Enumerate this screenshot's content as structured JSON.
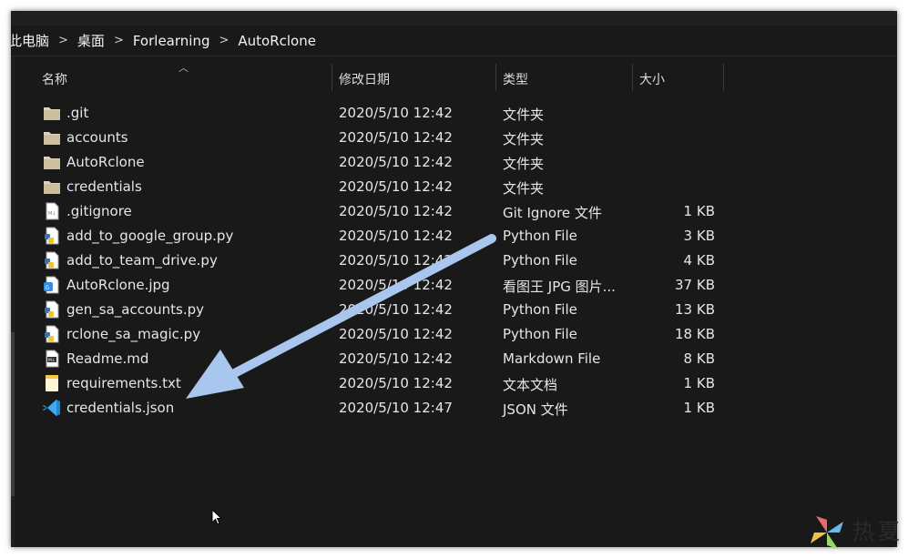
{
  "breadcrumb": [
    "此电脑",
    "桌面",
    "Forlearning",
    "AutoRclone"
  ],
  "columns": {
    "name": "名称",
    "date": "修改日期",
    "type": "类型",
    "size": "大小"
  },
  "files": [
    {
      "name": ".git",
      "date": "2020/5/10 12:42",
      "type": "文件夹",
      "size": "",
      "icon": "folder-icon"
    },
    {
      "name": "accounts",
      "date": "2020/5/10 12:42",
      "type": "文件夹",
      "size": "",
      "icon": "folder-icon"
    },
    {
      "name": "AutoRclone",
      "date": "2020/5/10 12:42",
      "type": "文件夹",
      "size": "",
      "icon": "folder-icon"
    },
    {
      "name": "credentials",
      "date": "2020/5/10 12:42",
      "type": "文件夹",
      "size": "",
      "icon": "folder-icon"
    },
    {
      "name": ".gitignore",
      "date": "2020/5/10 12:42",
      "type": "Git Ignore 文件",
      "size": "1 KB",
      "icon": "file-icon"
    },
    {
      "name": "add_to_google_group.py",
      "date": "2020/5/10 12:42",
      "type": "Python File",
      "size": "3 KB",
      "icon": "python-file-icon"
    },
    {
      "name": "add_to_team_drive.py",
      "date": "2020/5/10 12:42",
      "type": "Python File",
      "size": "4 KB",
      "icon": "python-file-icon"
    },
    {
      "name": "AutoRclone.jpg",
      "date": "2020/5/10 12:42",
      "type": "看图王 JPG 图片...",
      "size": "37 KB",
      "icon": "image-file-icon"
    },
    {
      "name": "gen_sa_accounts.py",
      "date": "2020/5/10 12:42",
      "type": "Python File",
      "size": "13 KB",
      "icon": "python-file-icon"
    },
    {
      "name": "rclone_sa_magic.py",
      "date": "2020/5/10 12:42",
      "type": "Python File",
      "size": "18 KB",
      "icon": "python-file-icon"
    },
    {
      "name": "Readme.md",
      "date": "2020/5/10 12:42",
      "type": "Markdown File",
      "size": "8 KB",
      "icon": "markdown-file-icon"
    },
    {
      "name": "requirements.txt",
      "date": "2020/5/10 12:42",
      "type": "文本文档",
      "size": "1 KB",
      "icon": "text-file-icon"
    },
    {
      "name": "credentials.json",
      "date": "2020/5/10 12:47",
      "type": "JSON 文件",
      "size": "1 KB",
      "icon": "vscode-icon"
    }
  ],
  "watermark": {
    "text": "热夏"
  },
  "colors": {
    "background": "#191919",
    "text": "#e6e6e6",
    "annotation_arrow": "#a9c7ee",
    "folder": "#dcd3bd"
  }
}
